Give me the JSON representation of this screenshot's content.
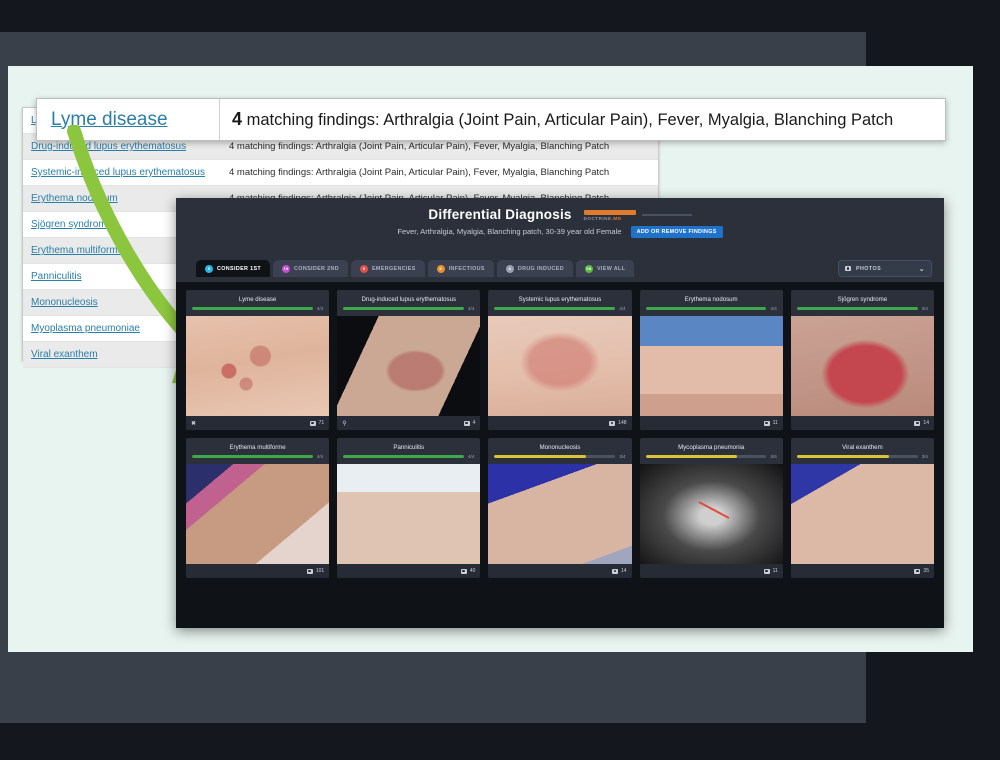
{
  "callout": {
    "diagnosis": "Lyme disease",
    "finding_count": "4",
    "finding_text": " matching findings: Arthralgia (Joint Pain, Articular Pain), Fever, Myalgia, Blanching Patch"
  },
  "findings_table": {
    "rows": [
      {
        "diagnosis": "Lyme disease",
        "findings": "4 matching findings: Arthralgia (Joint Pain, Articular Pain), Fever, Myalgia, Blanching Patch"
      },
      {
        "diagnosis": "Drug-induced lupus erythematosus",
        "findings": "4 matching findings: Arthralgia (Joint Pain, Articular Pain), Fever, Myalgia, Blanching Patch"
      },
      {
        "diagnosis": "Systemic-induced lupus erythematosus",
        "findings": "4 matching findings: Arthralgia (Joint Pain, Articular Pain), Fever, Myalgia, Blanching Patch"
      },
      {
        "diagnosis": "Erythema nodosum",
        "findings": "4 matching findings: Arthralgia (Joint Pain, Articular Pain), Fever, Myalgia, Blanching Patch"
      },
      {
        "diagnosis": "Sjögren syndrome",
        "findings": ""
      },
      {
        "diagnosis": "Erythema multiforme",
        "findings": ""
      },
      {
        "diagnosis": "Panniculitis",
        "findings": ""
      },
      {
        "diagnosis": "Mononucleosis",
        "findings": ""
      },
      {
        "diagnosis": "Myoplasma pneumoniae",
        "findings": ""
      },
      {
        "diagnosis": "Viral exanthem",
        "findings": ""
      }
    ]
  },
  "app": {
    "title": "Differential Diagnosis",
    "brand": "DOCTRINE",
    "brand_accent": ".MD",
    "subtitle": "Fever, Arthralgia, Myalgia, Blanching patch, 30-39 year old Female",
    "add_findings_label": "ADD OR REMOVE FINDINGS",
    "photos_dropdown": {
      "label": "PHOTOS",
      "icon": "camera-icon",
      "chevron": "⌄"
    },
    "tabs": [
      {
        "label": "CONSIDER 1ST",
        "badge": "9",
        "color": "#29b6e8",
        "active": true
      },
      {
        "label": "CONSIDER 2ND",
        "badge": "19",
        "color": "#c24cd6",
        "active": false
      },
      {
        "label": "EMERGENCIES",
        "badge": "9",
        "color": "#e0504a",
        "active": false
      },
      {
        "label": "INFECTIOUS",
        "badge": "8",
        "color": "#e8902c",
        "active": false
      },
      {
        "label": "DRUG INDUCED",
        "badge": "4",
        "color": "#9aa2b1",
        "active": false
      },
      {
        "label": "VIEW ALL",
        "badge": "58",
        "color": "#5aba3c",
        "active": false
      }
    ],
    "cards": [
      {
        "title": "Lyme disease",
        "score": "4/4",
        "bar_pct": 100,
        "bar_color": "#3fa84a",
        "photos": "71",
        "foot_icon": "tick-icon",
        "photo_class": "p1"
      },
      {
        "title": "Drug-induced lupus erythematosus",
        "score": "4/4",
        "bar_pct": 100,
        "bar_color": "#3fa84a",
        "photos": "4",
        "foot_icon": "pill-icon",
        "photo_class": "p2"
      },
      {
        "title": "Systemic lupus erythematosus",
        "score": "4/4",
        "bar_pct": 100,
        "bar_color": "#3fa84a",
        "photos": "148",
        "foot_icon": "",
        "photo_class": "p3"
      },
      {
        "title": "Erythema nodosum",
        "score": "4/4",
        "bar_pct": 100,
        "bar_color": "#3fa84a",
        "photos": "11",
        "foot_icon": "",
        "photo_class": "p4"
      },
      {
        "title": "Sjögren syndrome",
        "score": "4/4",
        "bar_pct": 100,
        "bar_color": "#3fa84a",
        "photos": "14",
        "foot_icon": "",
        "photo_class": "p5"
      },
      {
        "title": "Erythema multiforme",
        "score": "4/4",
        "bar_pct": 100,
        "bar_color": "#3fa84a",
        "photos": "101",
        "foot_icon": "",
        "photo_class": "p6"
      },
      {
        "title": "Panniculitis",
        "score": "4/4",
        "bar_pct": 100,
        "bar_color": "#3fa84a",
        "photos": "40",
        "foot_icon": "",
        "photo_class": "p7"
      },
      {
        "title": "Mononucleosis",
        "score": "3/4",
        "bar_pct": 76,
        "bar_color": "#d8c436",
        "photos": "14",
        "foot_icon": "",
        "photo_class": "p8"
      },
      {
        "title": "Mycoplasma pneumonia",
        "score": "3/4",
        "bar_pct": 76,
        "bar_color": "#d8c436",
        "photos": "11",
        "foot_icon": "",
        "photo_class": "p9"
      },
      {
        "title": "Viral exanthem",
        "score": "3/4",
        "bar_pct": 76,
        "bar_color": "#d8c436",
        "photos": "35",
        "foot_icon": "",
        "photo_class": "p10"
      }
    ]
  },
  "annotation": {
    "arrow_color": "#8cc63f",
    "arrow_name": "green-curved-arrow"
  }
}
